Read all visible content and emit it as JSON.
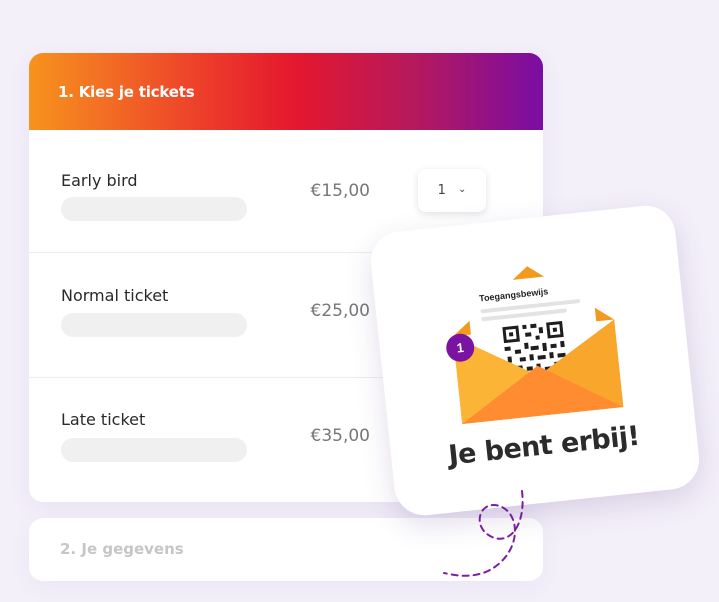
{
  "step1": {
    "title": "1. Kies je tickets",
    "tickets": [
      {
        "name": "Early bird",
        "price": "€15,00",
        "quantity": "1"
      },
      {
        "name": "Normal ticket",
        "price": "€25,00"
      },
      {
        "name": "Late ticket",
        "price": "€35,00"
      }
    ]
  },
  "step2": {
    "title": "2. Je gegevens"
  },
  "confirmation": {
    "ticket_label": "Toegangsbewijs",
    "badge_count": "1",
    "message": "Je bent erbij!"
  },
  "colors": {
    "gradient": [
      "#f7931e",
      "#e4172e",
      "#7a0da3"
    ],
    "badge": "#7a13a0",
    "envelope": "#fbb034"
  },
  "icons": [
    "chevron-down-icon",
    "envelope-icon",
    "qr-code-icon",
    "notification-badge",
    "dashed-swirl"
  ]
}
